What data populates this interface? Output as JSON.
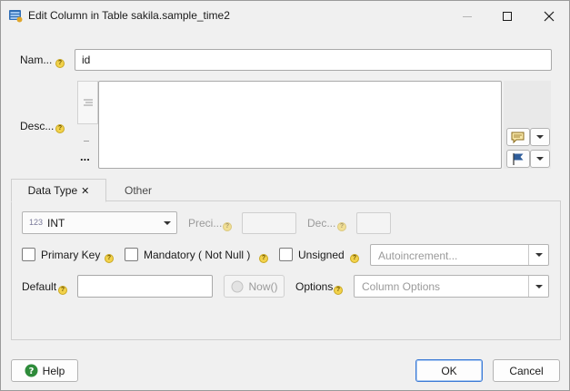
{
  "window": {
    "title": "Edit Column in Table sakila.sample_time2"
  },
  "form": {
    "name_label": "Nam...",
    "name_value": "id",
    "description_label": "Desc...",
    "description_value": "",
    "more_glyph": "..."
  },
  "tabs": [
    {
      "label": "Data Type",
      "close_glyph": "✕",
      "active": true
    },
    {
      "label": "Other",
      "active": false
    }
  ],
  "datatype": {
    "type_prefix": "123",
    "type_value": "INT",
    "precision_label": "Preci...",
    "precision_value": "",
    "decimals_label": "Dec...",
    "decimals_value": "",
    "primary_key_label": "Primary Key",
    "mandatory_label": "Mandatory ( Not Null )",
    "unsigned_label": "Unsigned",
    "autoincrement_placeholder": "Autoincrement...",
    "default_label": "Default",
    "default_value": "",
    "now_label": "Now()",
    "options_label": "Options",
    "options_placeholder": "Column Options"
  },
  "footer": {
    "help_label": "Help",
    "ok_label": "OK",
    "cancel_label": "Cancel"
  },
  "colors": {
    "default_button_border": "#3d7bd6",
    "help_icon": "#2e8b3a",
    "hint_icon": "#f2d24b"
  }
}
